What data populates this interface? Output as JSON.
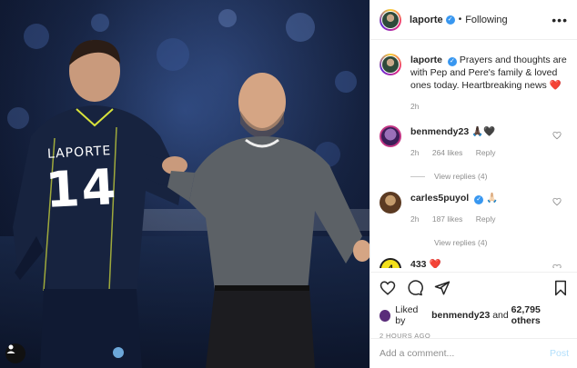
{
  "photo": {
    "jersey_name": "LAPORTE",
    "jersey_number": "14",
    "icons": [
      "profile-icon"
    ]
  },
  "post": {
    "username": "laporte",
    "separator": "•",
    "follow_status": "Following",
    "more_icon": "more-icon"
  },
  "caption": {
    "username": "laporte",
    "text": "Prayers and thoughts are with Pep and Pere's family & loved ones today. Heartbreaking news",
    "emoji": "❤️",
    "time": "2h"
  },
  "comments": [
    {
      "username": "benmendy23",
      "text": "🙏🏿🖤",
      "time": "2h",
      "likes": "264 likes",
      "reply": "Reply",
      "view_replies": "View replies (4)"
    },
    {
      "username": "carles5puyol",
      "text": "🙏🏻",
      "time": "2h",
      "likes": "187 likes",
      "reply": "Reply",
      "view_replies": "View replies (4)"
    },
    {
      "username": "433",
      "text": "❤️",
      "time": "",
      "likes": "",
      "reply": ""
    }
  ],
  "actions": {
    "icons": [
      "heart-icon",
      "comment-icon",
      "share-icon",
      "bookmark-icon"
    ],
    "liked_prefix": "Liked by",
    "liked_user": "benmendy23",
    "liked_and": "and",
    "liked_count": "62,795 others",
    "timestamp": "2 HOURS AGO"
  },
  "add_comment": {
    "placeholder": "Add a comment...",
    "post_label": "Post"
  },
  "colors": {
    "verified": "#3897f0",
    "heart": "#ed4956",
    "muted": "#8e8e8e",
    "post_disabled": "#b2dffc"
  }
}
